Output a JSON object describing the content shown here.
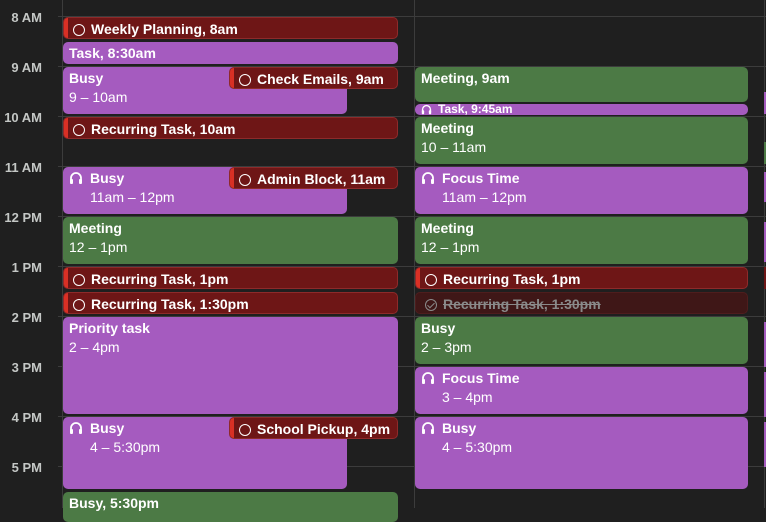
{
  "time_labels": [
    "8 AM",
    "9 AM",
    "10 AM",
    "11 AM",
    "12 PM",
    "1 PM",
    "2 PM",
    "3 PM",
    "4 PM",
    "5 PM"
  ],
  "col1": {
    "weekly_planning": "Weekly Planning, 8am",
    "task_830": "Task, 8:30am",
    "busy_9_title": "Busy",
    "busy_9_time": "9 – 10am",
    "check_emails": "Check Emails, 9am",
    "recurring_10": "Recurring Task, 10am",
    "busy_11_title": "Busy",
    "busy_11_time": "11am – 12pm",
    "admin_block": "Admin Block, 11am",
    "meeting_12_title": "Meeting",
    "meeting_12_time": "12 – 1pm",
    "recurring_1": "Recurring Task, 1pm",
    "recurring_130": "Recurring Task, 1:30pm",
    "priority_title": "Priority task",
    "priority_time": "2 – 4pm",
    "busy_4_title": "Busy",
    "busy_4_time": "4 – 5:30pm",
    "school_pickup": "School Pickup, 4pm",
    "busy_530": "Busy, 5:30pm"
  },
  "col2": {
    "meeting_9": "Meeting, 9am",
    "task_945": "Task, 9:45am",
    "meeting_10_title": "Meeting",
    "meeting_10_time": "10 – 11am",
    "focus_11_title": "Focus Time",
    "focus_11_time": "11am – 12pm",
    "meeting_12_title": "Meeting",
    "meeting_12_time": "12 – 1pm",
    "recurring_1": "Recurring Task, 1pm",
    "recurring_130": "Recurring Task, 1:30pm",
    "busy_2_title": "Busy",
    "busy_2_time": "2 – 3pm",
    "focus_3_title": "Focus Time",
    "focus_3_time": "3 – 4pm",
    "busy_4_title": "Busy",
    "busy_4_time": "4 – 5:30pm"
  },
  "colors": {
    "purple": "#a55bbf",
    "green": "#4c7a45",
    "task_red": "#6e1616",
    "task_accent": "#d93025"
  },
  "icons": {
    "task": "ring-icon",
    "focus": "headphones-icon",
    "done": "check-circle-icon"
  }
}
